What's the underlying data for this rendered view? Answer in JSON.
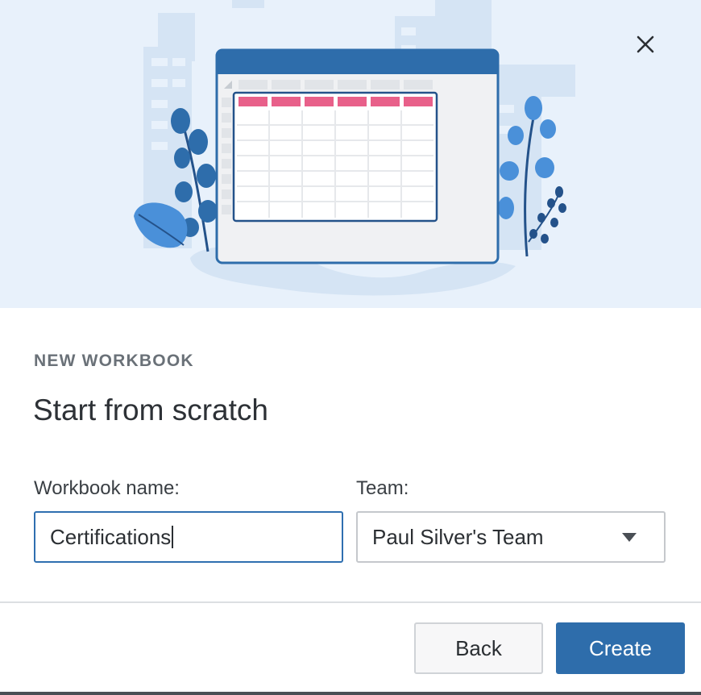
{
  "dialog": {
    "eyebrow": "NEW WORKBOOK",
    "title": "Start from scratch",
    "close_icon": "close-icon"
  },
  "form": {
    "workbook_name_label": "Workbook name:",
    "workbook_name_value": "Certifications",
    "team_label": "Team:",
    "team_selected": "Paul Silver's Team"
  },
  "footer": {
    "back_label": "Back",
    "create_label": "Create"
  },
  "colors": {
    "accent": "#2e6dab",
    "hero_background": "#e8f1fb",
    "table_header_pink": "#e8608a"
  }
}
